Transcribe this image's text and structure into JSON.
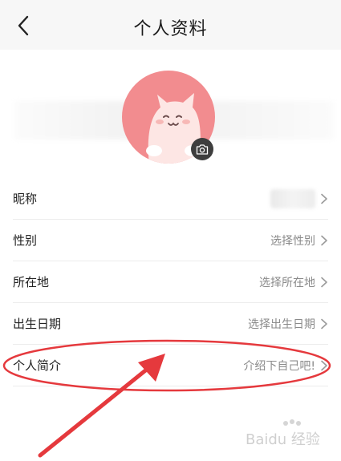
{
  "header": {
    "back_icon": "chevron-left-icon",
    "title": "个人资料"
  },
  "avatar": {
    "background_color": "#f28c8f",
    "camera_icon": "camera-icon"
  },
  "rows": [
    {
      "label": "昵称",
      "value": ""
    },
    {
      "label": "性别",
      "value": "选择性别"
    },
    {
      "label": "所在地",
      "value": "选择所在地"
    },
    {
      "label": "出生日期",
      "value": "选择出生日期"
    },
    {
      "label": "个人简介",
      "value": "介绍下自己吧!"
    }
  ],
  "annotation": {
    "color": "#e5393d"
  },
  "watermark": {
    "text": "Baidu 经验"
  }
}
